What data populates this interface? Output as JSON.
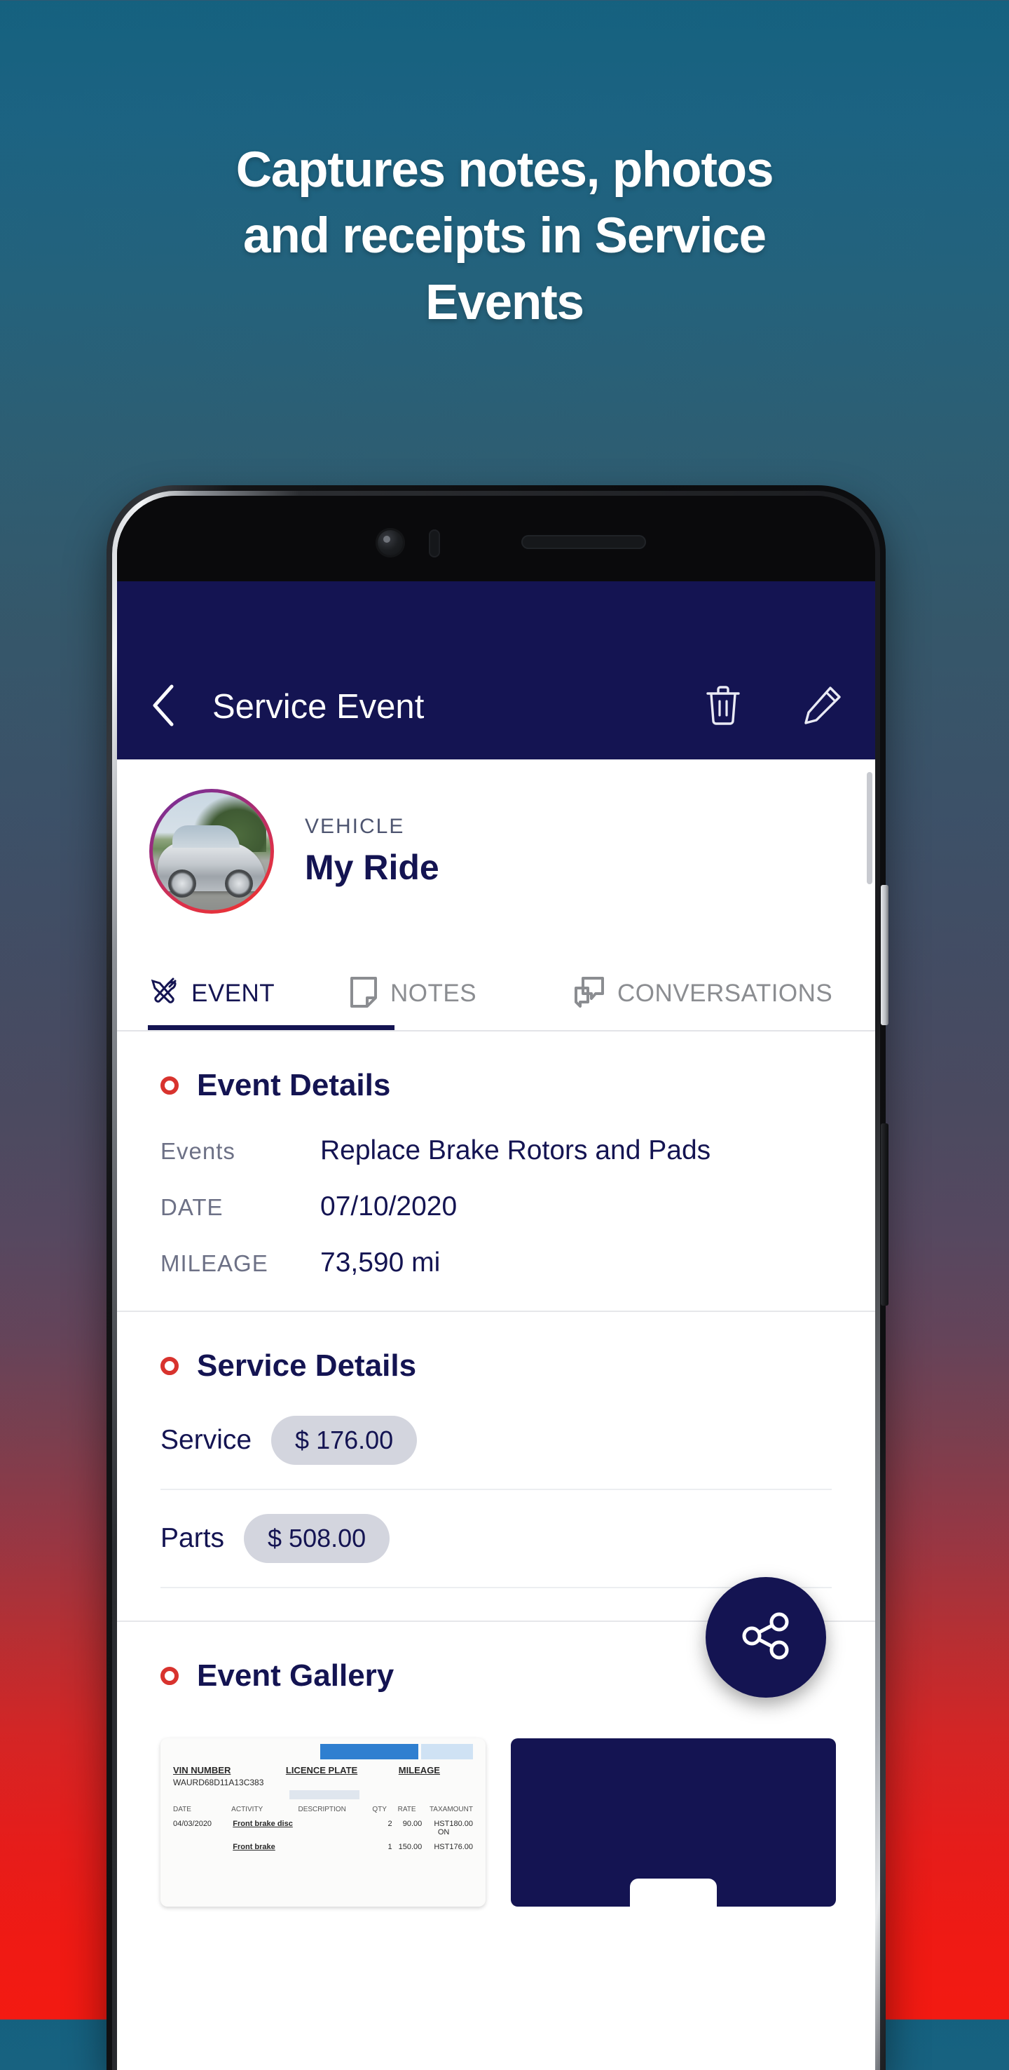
{
  "promo": {
    "headline_lines": [
      "Captures notes, photos",
      "and receipts in Service",
      "Events"
    ]
  },
  "colors": {
    "brand_navy": "#141452",
    "accent_red": "#d8332e",
    "chip_grey": "#d3d5de",
    "bg_top": "#15617f",
    "bg_bottom": "#f31a12"
  },
  "app": {
    "appbar": {
      "back_icon": "chevron-left-icon",
      "title": "Service Event",
      "delete_icon": "trash-icon",
      "edit_icon": "pencil-icon"
    },
    "vehicle": {
      "label": "VEHICLE",
      "name": "My Ride",
      "avatar_icon": "vehicle-photo"
    },
    "tabs": [
      {
        "label": "EVENT",
        "icon": "tools-icon",
        "active": true
      },
      {
        "label": "NOTES",
        "icon": "note-icon",
        "active": false
      },
      {
        "label": "CONVERSATIONS",
        "icon": "chat-icon",
        "active": false
      }
    ],
    "event_details": {
      "title": "Event Details",
      "rows": [
        {
          "label": "Events",
          "value": "Replace Brake Rotors and Pads"
        },
        {
          "label": "DATE",
          "value": "07/10/2020"
        },
        {
          "label": "MILEAGE",
          "value": "73,590 mi"
        }
      ]
    },
    "service_details": {
      "title": "Service Details",
      "items": [
        {
          "label": "Service",
          "amount": "$ 176.00"
        },
        {
          "label": "Parts",
          "amount": "$ 508.00"
        }
      ]
    },
    "event_gallery": {
      "title": "Event Gallery",
      "receipt": {
        "headers": [
          "VIN NUMBER",
          "LICENCE PLATE",
          "MILEAGE"
        ],
        "vin": "WAURD68D11A13C383",
        "col_headers": [
          "DATE",
          "ACTIVITY",
          "DESCRIPTION",
          "QTY",
          "RATE",
          "TAX",
          "AMOUNT"
        ],
        "lines": [
          {
            "date": "04/03/2020",
            "activity": "Front brake disc",
            "desc": "",
            "qty": "2",
            "rate": "90.00",
            "tax": "HST ON",
            "amount": "180.00"
          },
          {
            "date": "",
            "activity": "Front brake",
            "desc": "",
            "qty": "1",
            "rate": "150.00",
            "tax": "HST",
            "amount": "176.00"
          }
        ]
      }
    },
    "fab": {
      "icon": "share-icon",
      "label": "Share"
    }
  }
}
